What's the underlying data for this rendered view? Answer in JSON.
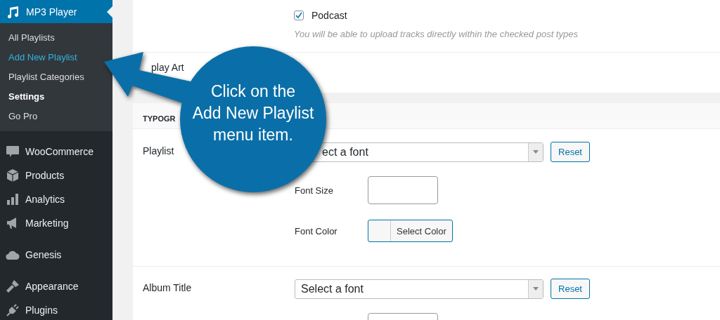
{
  "sidebar": {
    "header": {
      "label": "MP3 Player"
    },
    "submenu": [
      {
        "label": "All Playlists",
        "highlighted": false,
        "current": false
      },
      {
        "label": "Add New Playlist",
        "highlighted": true,
        "current": false
      },
      {
        "label": "Playlist Categories",
        "highlighted": false,
        "current": false
      },
      {
        "label": "Settings",
        "highlighted": false,
        "current": true
      },
      {
        "label": "Go Pro",
        "highlighted": false,
        "current": false
      }
    ],
    "items": [
      {
        "label": "WooCommerce"
      },
      {
        "label": "Products"
      },
      {
        "label": "Analytics"
      },
      {
        "label": "Marketing"
      },
      {
        "label": "Genesis"
      },
      {
        "label": "Appearance"
      },
      {
        "label": "Plugins"
      }
    ]
  },
  "post_types": {
    "options": [
      {
        "label": "Podcast",
        "checked": true
      }
    ],
    "hint": "You will be able to upload tracks directly within the checked post types"
  },
  "display_row": {
    "label": "play Art"
  },
  "typography": {
    "heading": "TYPOGR",
    "fields": [
      {
        "label": "Playlist",
        "select": "ect a font",
        "reset": "Reset",
        "font_size_label": "Font Size",
        "font_color_label": "Font Color",
        "color_button": "Select Color"
      },
      {
        "label": "Album Title",
        "select": "Select a font",
        "reset": "Reset"
      }
    ]
  },
  "callout": {
    "lines": [
      "Click on the",
      "Add New Playlist",
      "menu item."
    ]
  }
}
